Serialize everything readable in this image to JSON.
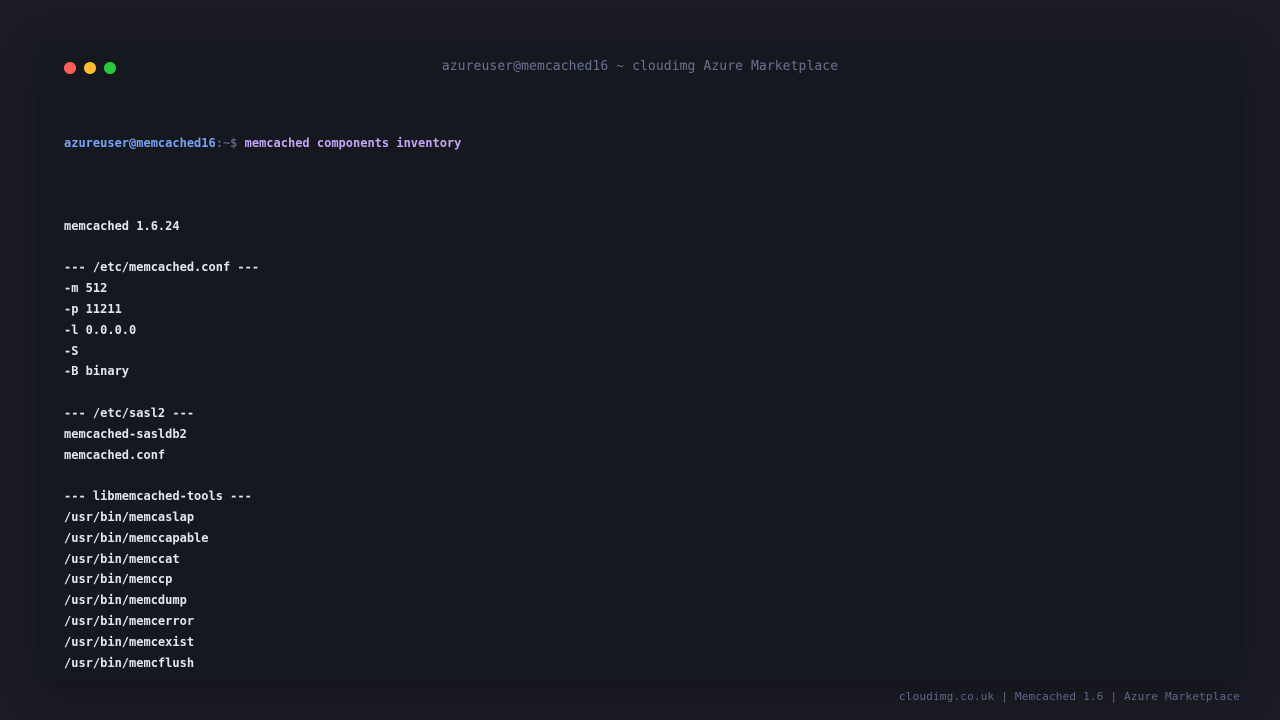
{
  "window": {
    "title": "azureuser@memcached16 ~ cloudimg Azure Marketplace",
    "controls": {
      "close_color": "#ff5f57",
      "minimize_color": "#febc2e",
      "maximize_color": "#28c840"
    }
  },
  "terminal": {
    "prompt": {
      "user_host": "azureuser@memcached16",
      "path_symbol": ":~$ ",
      "command": "memcached components inventory"
    },
    "output": [
      "",
      "memcached 1.6.24",
      "",
      "--- /etc/memcached.conf ---",
      "-m 512",
      "-p 11211",
      "-l 0.0.0.0",
      "-S",
      "-B binary",
      "",
      "--- /etc/sasl2 ---",
      "memcached-sasldb2",
      "memcached.conf",
      "",
      "--- libmemcached-tools ---",
      "/usr/bin/memcaslap",
      "/usr/bin/memccapable",
      "/usr/bin/memccat",
      "/usr/bin/memccp",
      "/usr/bin/memcdump",
      "/usr/bin/memcerror",
      "/usr/bin/memcexist",
      "/usr/bin/memcflush"
    ]
  },
  "footer": {
    "text": "cloudimg.co.uk | Memcached 1.6 | Azure Marketplace"
  }
}
